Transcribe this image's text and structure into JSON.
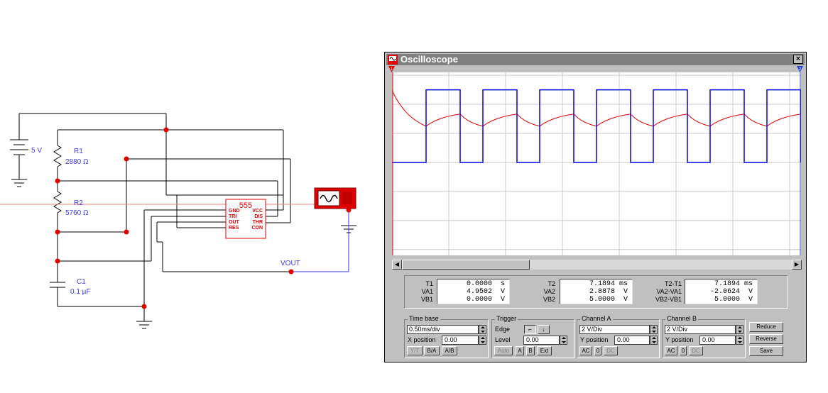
{
  "schematic": {
    "battery_label": "5 V",
    "r1_name": "R1",
    "r1_value": "2880 Ω",
    "r2_name": "R2",
    "r2_value": "5760 Ω",
    "c1_name": "C1",
    "c1_value": "0.1 µF",
    "ic_name": "555",
    "ic_pins_left": [
      "GND",
      "TRI",
      "OUT",
      "RES"
    ],
    "ic_pins_right": [
      "VCC",
      "DIS",
      "THR",
      "CON"
    ],
    "vout_label": "VOUT"
  },
  "window": {
    "title": "Oscilloscope",
    "close_label": "×"
  },
  "readouts": {
    "col1": {
      "labels": [
        "T1",
        "VA1",
        "VB1"
      ],
      "values": [
        "0.0000  s",
        "4.9502  V",
        "0.0000  V"
      ]
    },
    "col2": {
      "labels": [
        "T2",
        "VA2",
        "VB2"
      ],
      "values": [
        "7.1894 ms",
        "2.8878  V",
        "5.0000  V"
      ]
    },
    "col3": {
      "labels": [
        "T2-T1",
        "VA2-VA1",
        "VB2-VB1"
      ],
      "values": [
        "7.1894 ms",
        "-2.0624  V",
        "5.0000  V"
      ]
    }
  },
  "timebase": {
    "title": "Time base",
    "scale": "0.50ms/div",
    "xpos_label": "X position",
    "xpos_value": "0.00",
    "buttons": [
      "Y/T",
      "B/A",
      "A/B"
    ]
  },
  "trigger": {
    "title": "Trigger",
    "edge_label": "Edge",
    "edge_rise": "⌐",
    "edge_fall": "↓",
    "level_label": "Level",
    "level_value": "0.00",
    "buttons": [
      "Auto",
      "A",
      "B",
      "Ext"
    ]
  },
  "channel_a": {
    "title": "Channel A",
    "scale": "2 V/Div",
    "ypos_label": "Y position",
    "ypos_value": "0.00",
    "buttons": [
      "AC",
      "0",
      "DC"
    ]
  },
  "channel_b": {
    "title": "Channel B",
    "scale": "2 V/Div",
    "ypos_label": "Y position",
    "ypos_value": "0.00",
    "buttons": [
      "AC",
      "0",
      "DC"
    ]
  },
  "actions": {
    "reduce": "Reduce",
    "reverse": "Reverse",
    "save": "Save"
  },
  "markers": {
    "left": "1",
    "right": "2"
  },
  "colors": {
    "channel_a": "#e00000",
    "channel_b": "#0000e0",
    "grid": "#c8c8c8",
    "wire": "#000000",
    "probe_wire": "#3a3af0"
  },
  "chart_data": {
    "type": "line",
    "grid": true,
    "series": [
      {
        "x_divs": [
          0,
          0.6,
          1.2,
          1.6,
          2.2,
          2.6,
          3.2,
          3.6,
          4.2,
          4.6,
          5.2,
          5.6,
          6.2,
          6.6,
          7.2
        ],
        "values": [
          4.95,
          2.5,
          3.33,
          2.5,
          3.33,
          2.5,
          3.33,
          2.5,
          3.33,
          2.5,
          3.33,
          2.5,
          3.33,
          2.5,
          3.33
        ]
      },
      {
        "x_divs": [
          0,
          0.6,
          1.2,
          1.6,
          2.2,
          2.6,
          3.2,
          3.6,
          4.2,
          4.6,
          5.2,
          5.6,
          6.2,
          6.6,
          7.2
        ],
        "values": [
          0,
          5,
          0,
          5,
          0,
          5,
          0,
          5,
          0,
          5,
          0,
          5,
          0,
          5,
          0
        ]
      }
    ]
  }
}
